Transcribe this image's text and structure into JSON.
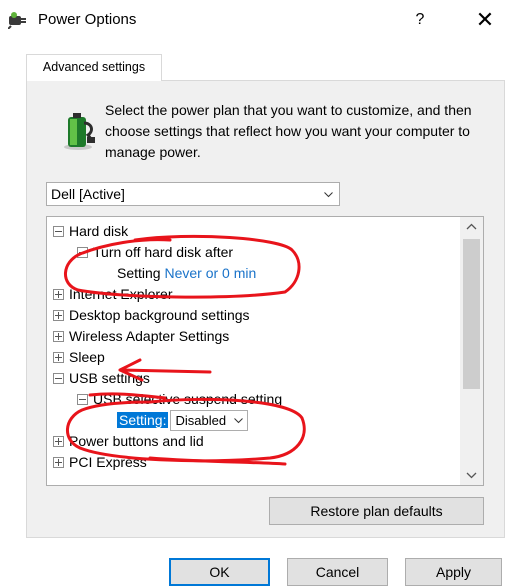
{
  "window": {
    "title": "Power Options"
  },
  "titlebar": {
    "help_label": "?",
    "close_label": "✕"
  },
  "tabs": [
    {
      "label": "Advanced settings"
    }
  ],
  "description": "Select the power plan that you want to customize, and then choose settings that reflect how you want your computer to manage power.",
  "plan_select": {
    "value": "Dell [Active]"
  },
  "tree": {
    "hard_disk": "Hard disk",
    "turn_off_hdd": "Turn off hard disk after",
    "hdd_setting_label": "Setting",
    "hdd_setting_value": "Never or 0 min",
    "internet_explorer": "Internet Explorer",
    "desktop_bg": "Desktop background settings",
    "wireless": "Wireless Adapter Settings",
    "sleep": "Sleep",
    "usb": "USB settings",
    "usb_selective": "USB selective suspend setting",
    "usb_setting_label": "Setting:",
    "usb_setting_value": "Disabled",
    "power_buttons": "Power buttons and lid",
    "pci_express": "PCI Express"
  },
  "buttons": {
    "restore": "Restore plan defaults",
    "ok": "OK",
    "cancel": "Cancel",
    "apply": "Apply"
  },
  "colors": {
    "accent": "#0078d7",
    "link": "#1a73c9",
    "annotation": "#e8141b"
  }
}
